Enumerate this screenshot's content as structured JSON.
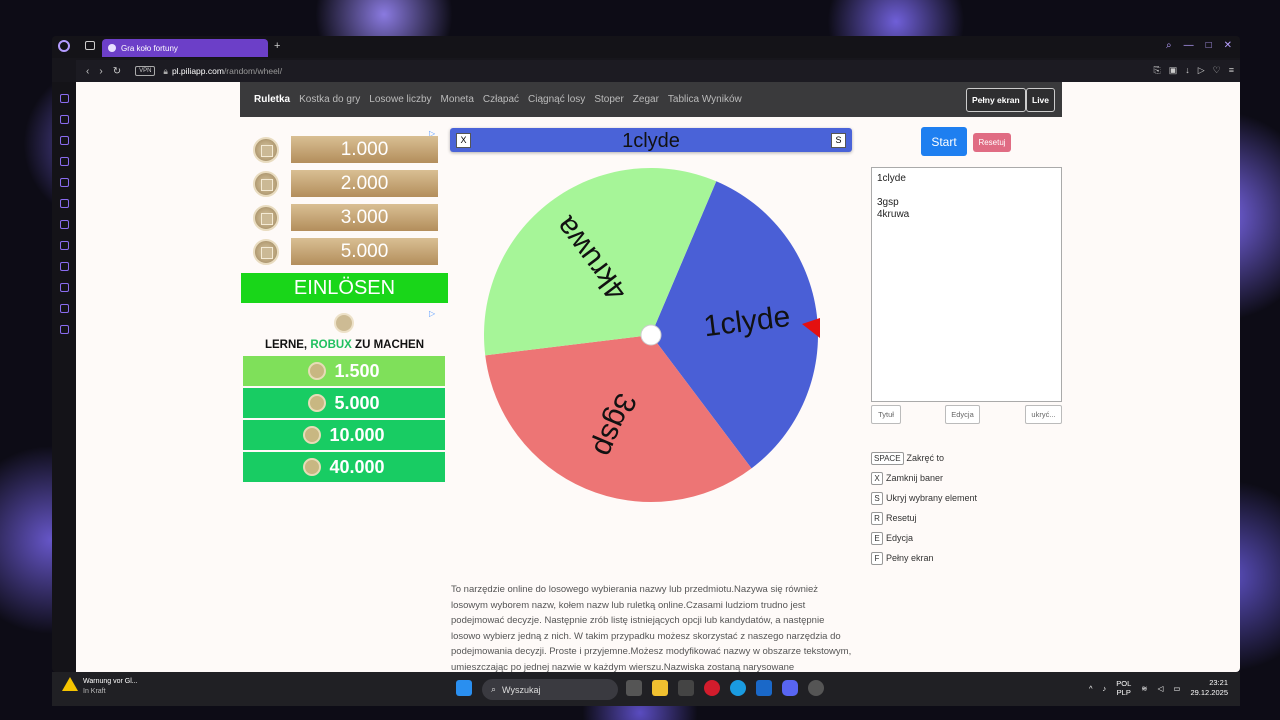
{
  "browser": {
    "tab_title": "Gra koło fortuny",
    "vpn_label": "VPN",
    "url_host": "pl.piliapp.com",
    "url_path": "/random/wheel/"
  },
  "topnav": {
    "items": [
      "Ruletka",
      "Kostka do gry",
      "Losowe liczby",
      "Moneta",
      "Człapać",
      "Ciągnąć losy",
      "Stoper",
      "Zegar",
      "Tablica Wyników"
    ],
    "fullscreen_label": "Pełny ekran",
    "live_label": "Live"
  },
  "ad1": {
    "amounts": [
      "1.000",
      "2.000",
      "3.000",
      "5.000"
    ],
    "button": "EINLÖSEN",
    "adchoice": "▷"
  },
  "ad2": {
    "headline_pre": "LERNE, ",
    "headline_hl": "ROBUX",
    "headline_post": " ZU MACHEN",
    "amounts": [
      "1.500",
      "5.000",
      "10.000",
      "40.000"
    ]
  },
  "banner": {
    "title": "1clyde",
    "close_key": "X",
    "hide_key": "S"
  },
  "wheel": {
    "segments": [
      {
        "label": "1clyde",
        "color": "#4a5fd6"
      },
      {
        "label": "3gsp",
        "color": "#ed7575"
      },
      {
        "label": "4kruwa",
        "color": "#a6f598"
      }
    ],
    "pointer_color": "#e41010"
  },
  "controls": {
    "start_label": "Start",
    "reset_label": "Resetuj",
    "textarea_value": "1clyde\n\n3gsp\n4kruwa",
    "title_btn": "Tytuł",
    "edit_btn": "Edycja",
    "hide_btn": "ukryć..."
  },
  "shortcuts": [
    {
      "key": "SPACE",
      "label": "Zakręć to"
    },
    {
      "key": "X",
      "label": "Zamknij baner"
    },
    {
      "key": "S",
      "label": "Ukryj wybrany element"
    },
    {
      "key": "R",
      "label": "Resetuj"
    },
    {
      "key": "E",
      "label": "Edycja"
    },
    {
      "key": "F",
      "label": "Pełny ekran"
    }
  ],
  "description": "To narzędzie online do losowego wybierania nazwy lub przedmiotu.Nazywa się również losowym wyborem nazw, kołem nazw lub ruletką online.Czasami ludziom trudno jest podejmować decyzje. Następnie zrób listę istniejących opcji lub kandydatów, a następnie losowo wybierz jedną z nich. W takim przypadku możesz skorzystać z naszego narzędzia do podejmowania decyzji. Proste i przyjemne.Możesz modyfikować nazwy w obszarze tekstowym, umieszczając po jednej nazwie w każdym wierszu.Nazwiska zostaną narysowane",
  "taskbar": {
    "notify_title": "Warnung vor Gl...",
    "notify_sub": "In Kraft",
    "search_label": "Wyszukaj",
    "lang1": "POL",
    "lang2": "PLP",
    "time": "23:21",
    "date": "29.12.2025"
  }
}
